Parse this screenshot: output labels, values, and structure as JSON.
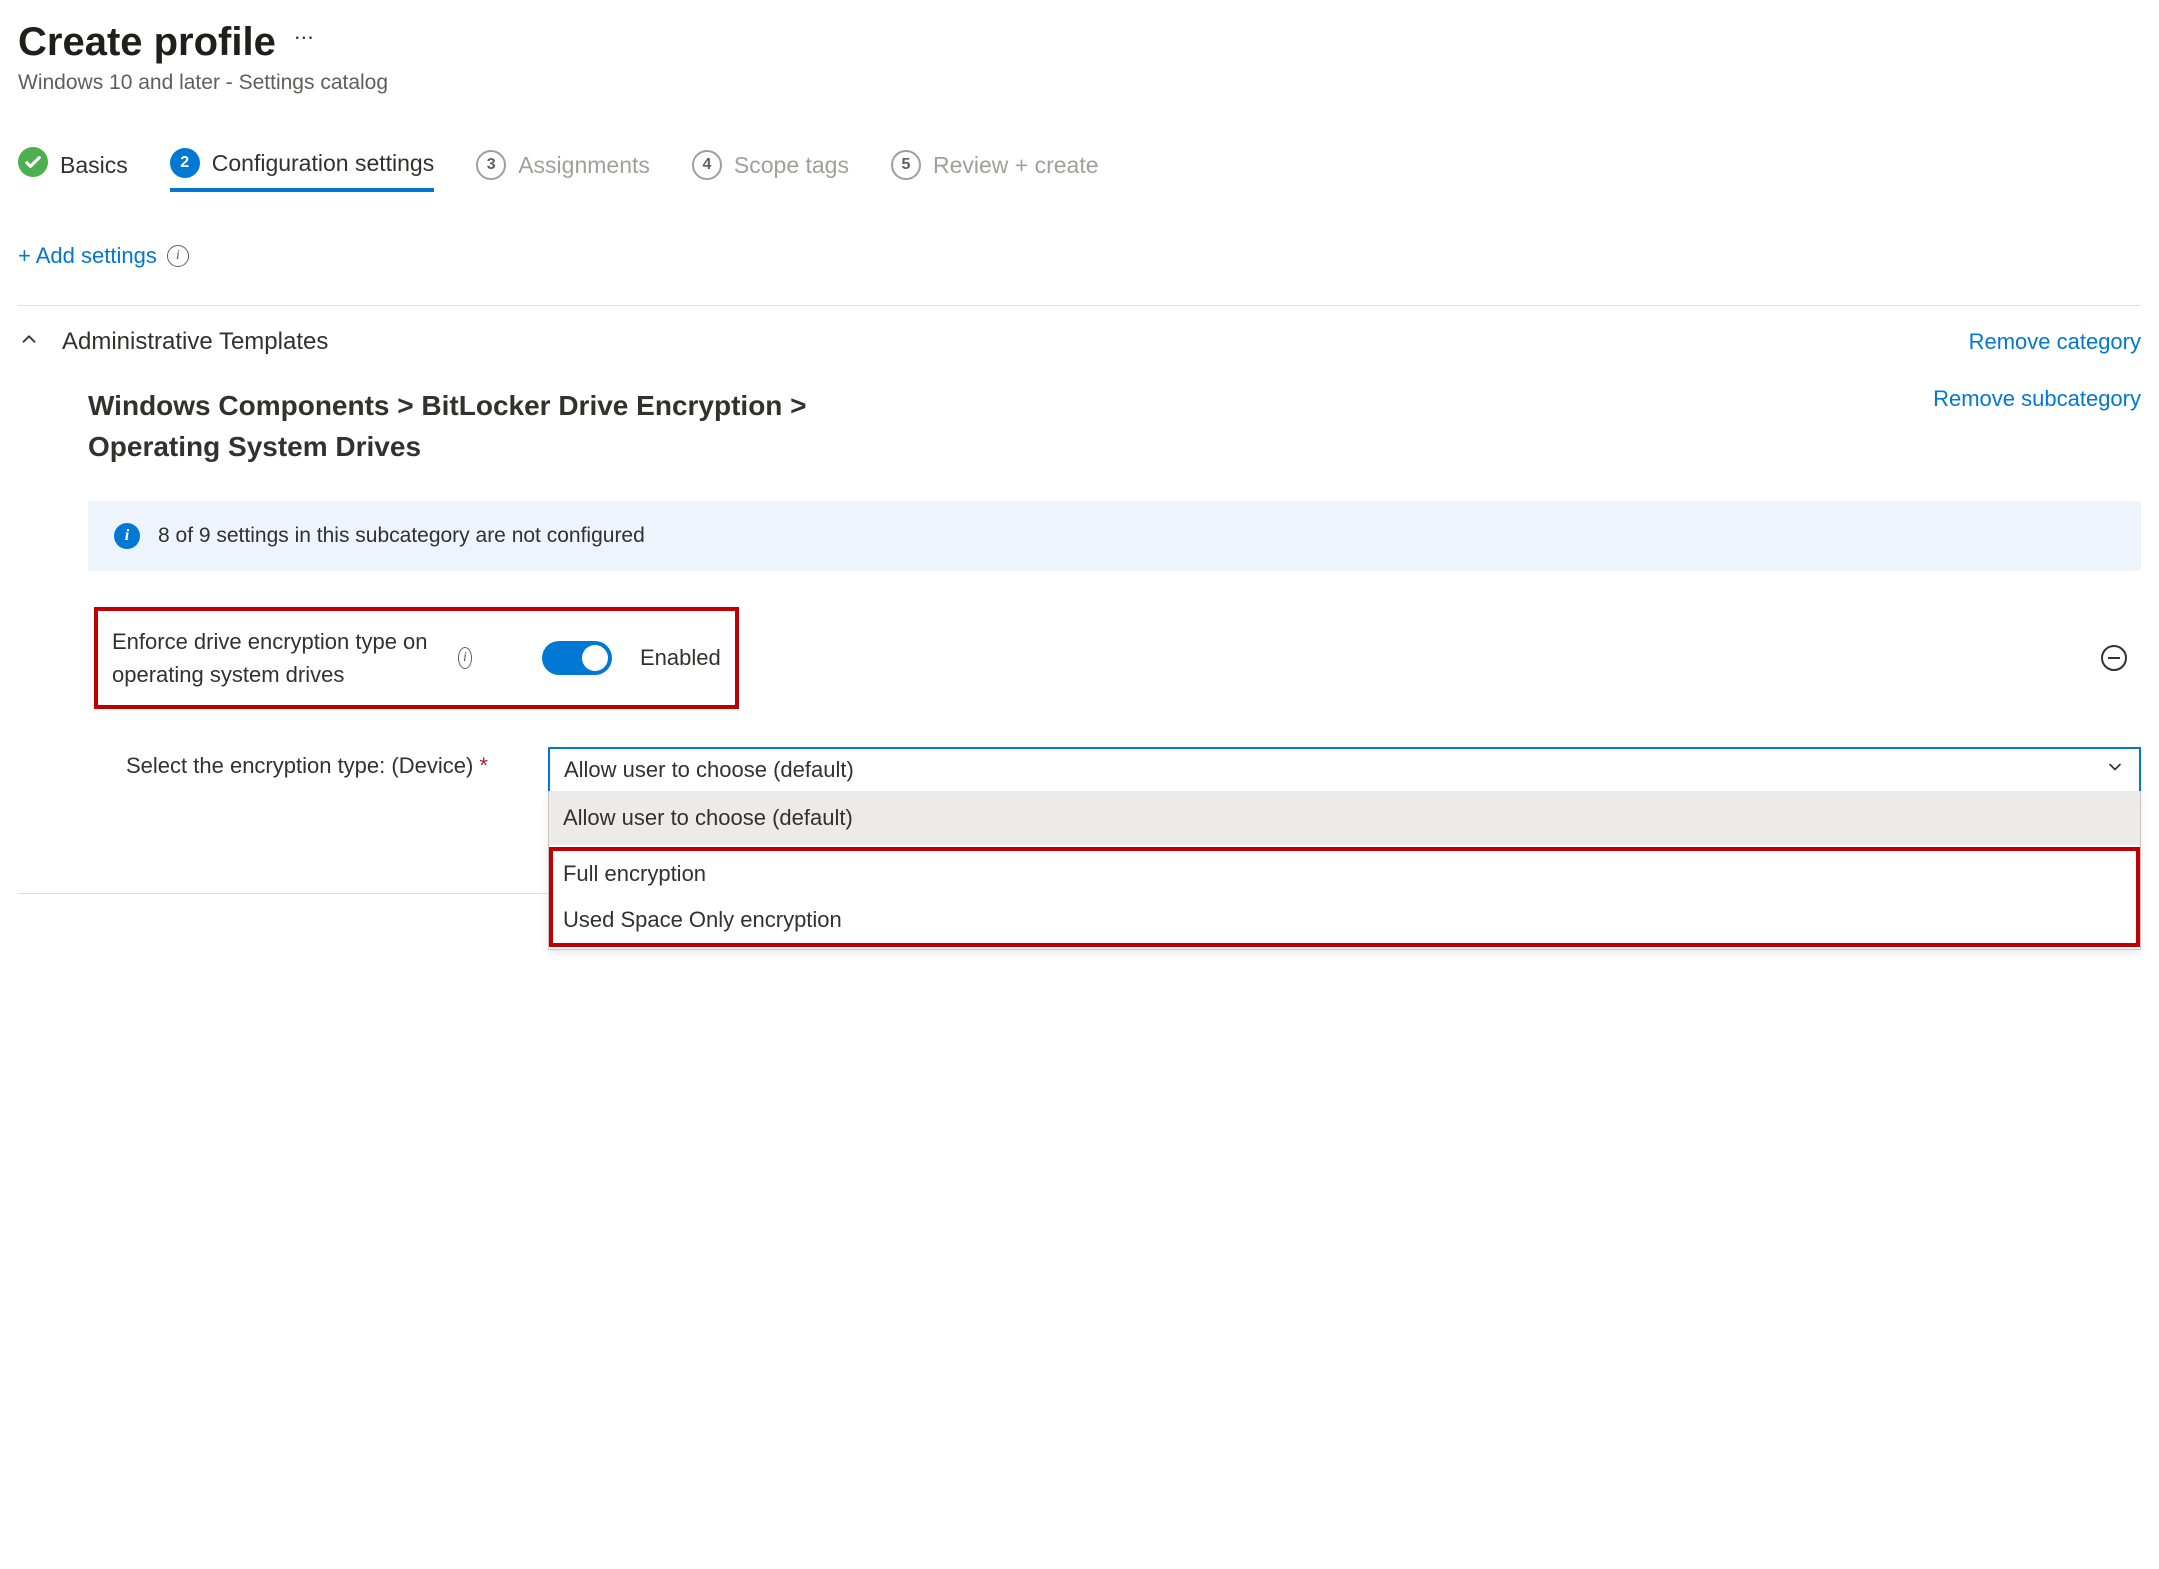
{
  "header": {
    "title": "Create profile",
    "subtitle": "Windows 10 and later - Settings catalog"
  },
  "steps": {
    "items": [
      {
        "num": "1",
        "label": "Basics",
        "state": "done"
      },
      {
        "num": "2",
        "label": "Configuration settings",
        "state": "active"
      },
      {
        "num": "3",
        "label": "Assignments",
        "state": "pending"
      },
      {
        "num": "4",
        "label": "Scope tags",
        "state": "pending"
      },
      {
        "num": "5",
        "label": "Review + create",
        "state": "pending"
      }
    ]
  },
  "addSettings": {
    "label": "+ Add settings"
  },
  "category": {
    "name": "Administrative Templates",
    "removeLabel": "Remove category"
  },
  "subcategory": {
    "path": "Windows Components > BitLocker Drive Encryption > Operating System Drives",
    "removeLabel": "Remove subcategory"
  },
  "infoBanner": {
    "text": "8 of 9 settings in this subcategory are not configured"
  },
  "setting": {
    "label": "Enforce drive encryption type on operating system drives",
    "toggle": {
      "state": "Enabled",
      "on": true
    }
  },
  "selectField": {
    "label": "Select the encryption type: (Device)",
    "required": "*",
    "value": "Allow user to choose (default)",
    "options": [
      "Allow user to choose (default)",
      "Full encryption",
      "Used Space Only encryption"
    ]
  }
}
